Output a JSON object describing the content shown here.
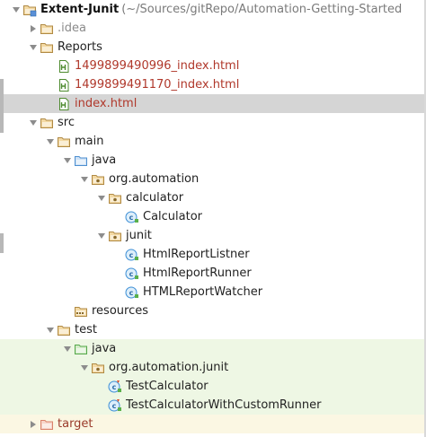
{
  "project_tree": {
    "rows": [
      {
        "id": "extent-junit",
        "label": "Extent-Junit",
        "hint": "(~/Sources/gitRepo/Automation-Getting-Started",
        "depth": 0,
        "expanded": true,
        "icon": "module-folder-icon",
        "style": "bold"
      },
      {
        "id": "idea",
        "label": ".idea",
        "depth": 1,
        "expanded": false,
        "icon": "folder-icon",
        "style": "muted"
      },
      {
        "id": "reports",
        "label": "Reports",
        "depth": 1,
        "expanded": true,
        "icon": "folder-icon",
        "style": "normal"
      },
      {
        "id": "report-1",
        "label": "1499899490996_index.html",
        "depth": 2,
        "icon": "html-file-icon",
        "style": "brown"
      },
      {
        "id": "report-2",
        "label": "1499899491170_index.html",
        "depth": 2,
        "icon": "html-file-icon",
        "style": "brown"
      },
      {
        "id": "index-html",
        "label": "index.html",
        "depth": 2,
        "icon": "html-file-icon",
        "style": "brown",
        "selected": true
      },
      {
        "id": "src",
        "label": "src",
        "depth": 1,
        "expanded": true,
        "icon": "folder-icon",
        "style": "normal"
      },
      {
        "id": "main",
        "label": "main",
        "depth": 2,
        "expanded": true,
        "icon": "folder-icon",
        "style": "normal"
      },
      {
        "id": "main-java",
        "label": "java",
        "depth": 3,
        "expanded": true,
        "icon": "source-folder-icon",
        "style": "normal"
      },
      {
        "id": "org-automation",
        "label": "org.automation",
        "depth": 4,
        "expanded": true,
        "icon": "package-icon",
        "style": "normal"
      },
      {
        "id": "calculator-pkg",
        "label": "calculator",
        "depth": 5,
        "expanded": true,
        "icon": "package-icon",
        "style": "normal"
      },
      {
        "id": "calculator-class",
        "label": "Calculator",
        "depth": 6,
        "icon": "class-icon",
        "style": "normal"
      },
      {
        "id": "junit-pkg",
        "label": "junit",
        "depth": 5,
        "expanded": true,
        "icon": "package-icon",
        "style": "normal"
      },
      {
        "id": "html-report-listner",
        "label": "HtmlReportListner",
        "depth": 6,
        "icon": "class-icon",
        "style": "normal"
      },
      {
        "id": "html-report-runner",
        "label": "HtmlReportRunner",
        "depth": 6,
        "icon": "class-icon",
        "style": "normal"
      },
      {
        "id": "html-report-watcher",
        "label": "HTMLReportWatcher",
        "depth": 6,
        "icon": "class-icon",
        "style": "normal"
      },
      {
        "id": "resources",
        "label": "resources",
        "depth": 3,
        "icon": "resources-folder-icon",
        "style": "normal"
      },
      {
        "id": "test",
        "label": "test",
        "depth": 2,
        "expanded": true,
        "icon": "folder-icon",
        "style": "normal"
      },
      {
        "id": "test-java",
        "label": "java",
        "depth": 3,
        "expanded": true,
        "icon": "test-folder-icon",
        "style": "normal",
        "scope": "test"
      },
      {
        "id": "org-automation-junit",
        "label": "org.automation.junit",
        "depth": 4,
        "expanded": true,
        "icon": "package-icon",
        "style": "normal",
        "scope": "test"
      },
      {
        "id": "test-calculator",
        "label": "TestCalculator",
        "depth": 5,
        "icon": "test-class-icon",
        "style": "normal",
        "scope": "test"
      },
      {
        "id": "test-calculator-custom",
        "label": "TestCalculatorWithCustomRunner",
        "depth": 5,
        "icon": "test-class-icon",
        "style": "normal",
        "scope": "test"
      },
      {
        "id": "target",
        "label": "target",
        "depth": 1,
        "expanded": false,
        "icon": "excluded-folder-icon",
        "style": "darkred",
        "scope": "excluded"
      }
    ]
  },
  "colors": {
    "folder_stroke": "#b08a45",
    "folder_fill": "#f3d9a3",
    "source_folder": "#4d8fd0",
    "test_folder": "#55a84a",
    "excluded_folder": "#d9826b",
    "class_circle": "#3d8fd6",
    "html_file": "#4d8a2e",
    "selection": "#d5d5d5",
    "test_scope": "#eef7e4"
  }
}
